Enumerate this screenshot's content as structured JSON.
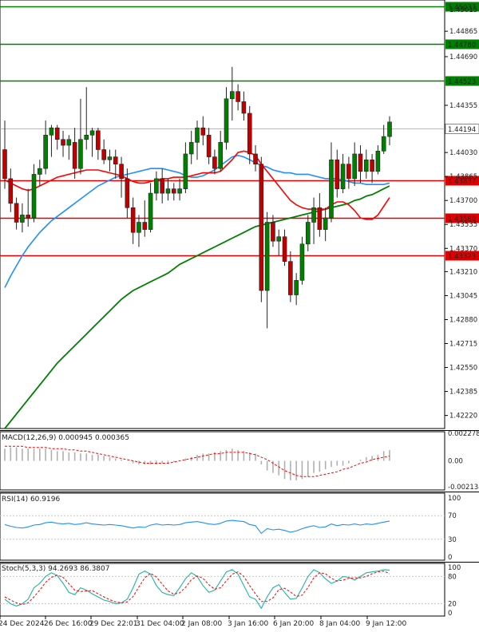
{
  "chart_data": [
    {
      "type": "candlestick",
      "panel": "main",
      "ylim": [
        1.4213,
        1.4508
      ],
      "yticks": [
        "1.44865",
        "1.44690",
        "1.44355",
        "1.44030",
        "1.43865",
        "1.43700",
        "1.43535",
        "1.43370",
        "1.43210",
        "1.43045",
        "1.42880",
        "1.42715",
        "1.42550",
        "1.42385",
        "1.42220"
      ],
      "ytick_top_partial": [
        "1.45180",
        "1.45015"
      ],
      "current_price": "1.44194",
      "levels": [
        {
          "price": "1.45037",
          "color": "#008000"
        },
        {
          "price": "1.44780",
          "color": "#008000"
        },
        {
          "price": "1.44523",
          "color": "#008000"
        },
        {
          "price": "1.43837",
          "color": "#e00000"
        },
        {
          "price": "1.43580",
          "color": "#e00000"
        },
        {
          "price": "1.43323",
          "color": "#e00000"
        }
      ],
      "candles": [
        [
          1.4405,
          1.4425,
          1.4378,
          1.4385
        ],
        [
          1.4385,
          1.4392,
          1.4362,
          1.4368
        ],
        [
          1.4368,
          1.4372,
          1.435,
          1.4355
        ],
        [
          1.4355,
          1.4368,
          1.4348,
          1.436
        ],
        [
          1.436,
          1.4378,
          1.4352,
          1.4358
        ],
        [
          1.4358,
          1.4395,
          1.4355,
          1.4388
        ],
        [
          1.4388,
          1.4398,
          1.438,
          1.4392
        ],
        [
          1.4392,
          1.4425,
          1.4388,
          1.4415
        ],
        [
          1.4415,
          1.4422,
          1.44,
          1.442
        ],
        [
          1.442,
          1.4422,
          1.4405,
          1.4412
        ],
        [
          1.4412,
          1.4418,
          1.44,
          1.4408
        ],
        [
          1.4408,
          1.4415,
          1.4398,
          1.4412
        ],
        [
          1.441,
          1.442,
          1.4385,
          1.4392
        ],
        [
          1.4392,
          1.444,
          1.4388,
          1.4412
        ],
        [
          1.4412,
          1.4448,
          1.4405,
          1.4415
        ],
        [
          1.4415,
          1.442,
          1.44,
          1.4418
        ],
        [
          1.4418,
          1.442,
          1.4398,
          1.4405
        ],
        [
          1.4405,
          1.4412,
          1.4395,
          1.4398
        ],
        [
          1.4398,
          1.4405,
          1.439,
          1.44
        ],
        [
          1.44,
          1.4405,
          1.4385,
          1.4395
        ],
        [
          1.4395,
          1.44,
          1.4372,
          1.4385
        ],
        [
          1.4385,
          1.4392,
          1.4358,
          1.4365
        ],
        [
          1.4365,
          1.4372,
          1.434,
          1.4348
        ],
        [
          1.4348,
          1.436,
          1.4338,
          1.4355
        ],
        [
          1.4355,
          1.437,
          1.4345,
          1.435
        ],
        [
          1.435,
          1.4382,
          1.4348,
          1.4375
        ],
        [
          1.4375,
          1.439,
          1.437,
          1.4385
        ],
        [
          1.4385,
          1.4392,
          1.4368,
          1.4375
        ],
        [
          1.4375,
          1.4385,
          1.437,
          1.4378
        ],
        [
          1.4378,
          1.4382,
          1.437,
          1.4375
        ],
        [
          1.4375,
          1.4385,
          1.437,
          1.4378
        ],
        [
          1.4378,
          1.441,
          1.4375,
          1.4402
        ],
        [
          1.4402,
          1.4418,
          1.4395,
          1.441
        ],
        [
          1.441,
          1.4425,
          1.4398,
          1.442
        ],
        [
          1.442,
          1.4428,
          1.4408,
          1.4415
        ],
        [
          1.4415,
          1.442,
          1.4395,
          1.44
        ],
        [
          1.44,
          1.4405,
          1.4388,
          1.4392
        ],
        [
          1.4392,
          1.4418,
          1.439,
          1.441
        ],
        [
          1.441,
          1.4448,
          1.4405,
          1.444
        ],
        [
          1.444,
          1.4462,
          1.4425,
          1.4445
        ],
        [
          1.4445,
          1.445,
          1.4432,
          1.4438
        ],
        [
          1.4438,
          1.4445,
          1.4425,
          1.443
        ],
        [
          1.443,
          1.4435,
          1.4395,
          1.4402
        ],
        [
          1.4402,
          1.4408,
          1.439,
          1.4395
        ],
        [
          1.4395,
          1.44,
          1.43,
          1.4308
        ],
        [
          1.4308,
          1.4362,
          1.4282,
          1.4355
        ],
        [
          1.4355,
          1.436,
          1.4338,
          1.4342
        ],
        [
          1.4342,
          1.435,
          1.4332,
          1.4345
        ],
        [
          1.4345,
          1.435,
          1.4325,
          1.4328
        ],
        [
          1.4328,
          1.4335,
          1.43,
          1.4305
        ],
        [
          1.4305,
          1.432,
          1.4298,
          1.4315
        ],
        [
          1.4315,
          1.4345,
          1.4312,
          1.434
        ],
        [
          1.434,
          1.436,
          1.4335,
          1.4355
        ],
        [
          1.4355,
          1.4372,
          1.434,
          1.4365
        ],
        [
          1.4365,
          1.4375,
          1.4345,
          1.435
        ],
        [
          1.435,
          1.4365,
          1.4342,
          1.4358
        ],
        [
          1.4358,
          1.441,
          1.4355,
          1.4398
        ],
        [
          1.4398,
          1.4405,
          1.4372,
          1.4378
        ],
        [
          1.4378,
          1.4402,
          1.4375,
          1.4395
        ],
        [
          1.4395,
          1.44,
          1.4378,
          1.4385
        ],
        [
          1.4385,
          1.441,
          1.438,
          1.4402
        ],
        [
          1.4402,
          1.4408,
          1.4382,
          1.439
        ],
        [
          1.439,
          1.4405,
          1.4385,
          1.4398
        ],
        [
          1.4398,
          1.4402,
          1.4382,
          1.439
        ],
        [
          1.439,
          1.4408,
          1.4388,
          1.4404
        ],
        [
          1.4404,
          1.4422,
          1.4402,
          1.4414
        ],
        [
          1.4414,
          1.4428,
          1.4408,
          1.4424
        ]
      ],
      "ma_red": [
        1.4384,
        1.4382,
        1.438,
        1.4378,
        1.4377,
        1.4378,
        1.438,
        1.4382,
        1.4384,
        1.4386,
        1.4387,
        1.4388,
        1.4389,
        1.439,
        1.4391,
        1.4391,
        1.4391,
        1.439,
        1.4389,
        1.4388,
        1.4387,
        1.4385,
        1.4383,
        1.4382,
        1.4382,
        1.4383,
        1.4384,
        1.4385,
        1.4385,
        1.4386,
        1.4386,
        1.4386,
        1.4387,
        1.4388,
        1.4389,
        1.4389,
        1.4389,
        1.439,
        1.4394,
        1.4398,
        1.4403,
        1.4404,
        1.4403,
        1.4401,
        1.4395,
        1.439,
        1.4385,
        1.438,
        1.4375,
        1.437,
        1.4367,
        1.4365,
        1.4364,
        1.4364,
        1.4364,
        1.4364,
        1.4367,
        1.4369,
        1.4369,
        1.4367,
        1.4363,
        1.4358,
        1.4357,
        1.4357,
        1.436,
        1.4366,
        1.4372
      ],
      "ma_blue": [
        1.431,
        1.4318,
        1.4325,
        1.4332,
        1.4338,
        1.4343,
        1.4348,
        1.4352,
        1.4356,
        1.4359,
        1.4362,
        1.4365,
        1.4368,
        1.4371,
        1.4374,
        1.4377,
        1.438,
        1.4382,
        1.4384,
        1.4386,
        1.4387,
        1.4388,
        1.4389,
        1.439,
        1.4391,
        1.4392,
        1.4392,
        1.4392,
        1.4391,
        1.439,
        1.4389,
        1.4387,
        1.4386,
        1.4386,
        1.4387,
        1.4389,
        1.4391,
        1.4394,
        1.4397,
        1.44,
        1.4401,
        1.44,
        1.4398,
        1.4396,
        1.4394,
        1.4393,
        1.4391,
        1.439,
        1.4389,
        1.4389,
        1.4388,
        1.4388,
        1.4388,
        1.4387,
        1.4386,
        1.4385,
        1.4385,
        1.4385,
        1.4384,
        1.4383,
        1.4382,
        1.4382,
        1.4381,
        1.4381,
        1.4381,
        1.4381,
        1.4382
      ],
      "ma_green": [
        1.4213,
        1.4218,
        1.4223,
        1.4228,
        1.4233,
        1.4238,
        1.4243,
        1.4248,
        1.4253,
        1.4258,
        1.4262,
        1.4266,
        1.427,
        1.4274,
        1.4278,
        1.4282,
        1.4286,
        1.429,
        1.4294,
        1.4298,
        1.4302,
        1.4305,
        1.4308,
        1.431,
        1.4312,
        1.4314,
        1.4316,
        1.4318,
        1.432,
        1.4323,
        1.4326,
        1.4328,
        1.433,
        1.4332,
        1.4334,
        1.4336,
        1.4338,
        1.434,
        1.4342,
        1.4344,
        1.4346,
        1.4348,
        1.435,
        1.4352,
        1.4353,
        1.4354,
        1.4355,
        1.4356,
        1.4357,
        1.4358,
        1.4359,
        1.436,
        1.4361,
        1.4362,
        1.4363,
        1.4364,
        1.4365,
        1.4366,
        1.4367,
        1.4368,
        1.437,
        1.4371,
        1.4373,
        1.4374,
        1.4376,
        1.4378,
        1.438
      ]
    },
    {
      "type": "bar",
      "panel": "macd",
      "label": "MACD(12,26,9) 0.000945 0.000365",
      "ylim": [
        -0.0024,
        0.0024
      ],
      "yticks": [
        "0.002278",
        "0.00",
        "-0.002134"
      ],
      "histogram": [
        0.001,
        0.0011,
        0.0011,
        0.001,
        0.001,
        0.001,
        0.001,
        0.001,
        0.0009,
        0.0008,
        0.0008,
        0.0007,
        0.0007,
        0.0006,
        0.0006,
        0.0005,
        0.0005,
        0.0004,
        0.0003,
        0.0002,
        0.0001,
        0.0,
        -0.0002,
        -0.0003,
        -0.0003,
        -0.0003,
        -0.0003,
        -0.0002,
        -0.0002,
        -0.0001,
        0.0,
        0.0002,
        0.0003,
        0.0005,
        0.0006,
        0.0006,
        0.0007,
        0.0008,
        0.0009,
        0.001,
        0.0009,
        0.0008,
        0.0007,
        0.0006,
        -0.0003,
        -0.0008,
        -0.001,
        -0.0012,
        -0.0015,
        -0.0016,
        -0.0016,
        -0.0015,
        -0.0013,
        -0.001,
        -0.0009,
        -0.0007,
        -0.0005,
        -0.0004,
        -0.0004,
        -0.0002,
        0.0,
        0.0001,
        0.0003,
        0.0004,
        0.0005,
        0.0008,
        0.0009
      ],
      "signal": [
        0.0012,
        0.0012,
        0.0012,
        0.0012,
        0.0011,
        0.0011,
        0.0011,
        0.0011,
        0.001,
        0.001,
        0.001,
        0.0009,
        0.0009,
        0.0008,
        0.0008,
        0.0007,
        0.0006,
        0.0005,
        0.0004,
        0.0003,
        0.0002,
        0.0001,
        0.0,
        -0.0001,
        -0.0002,
        -0.0002,
        -0.0002,
        -0.0002,
        -0.0002,
        -0.0001,
        0.0,
        0.0001,
        0.0002,
        0.0003,
        0.0004,
        0.0005,
        0.0006,
        0.0006,
        0.0007,
        0.0007,
        0.0007,
        0.0007,
        0.0006,
        0.0005,
        0.0003,
        0.0001,
        -0.0002,
        -0.0005,
        -0.0008,
        -0.001,
        -0.0012,
        -0.0013,
        -0.0013,
        -0.0013,
        -0.0012,
        -0.0011,
        -0.001,
        -0.0009,
        -0.0007,
        -0.0006,
        -0.0004,
        -0.0002,
        -0.0001,
        0.0001,
        0.0002,
        0.0003,
        0.0004
      ]
    },
    {
      "type": "line",
      "panel": "rsi",
      "label": "RSI(14) 60.9196",
      "ylim": [
        0,
        100
      ],
      "yticks": [
        "100",
        "70",
        "30",
        "0"
      ],
      "values": [
        55,
        52,
        50,
        49,
        51,
        54,
        55,
        58,
        59,
        57,
        56,
        57,
        55,
        56,
        58,
        56,
        55,
        54,
        55,
        54,
        53,
        51,
        49,
        51,
        50,
        54,
        56,
        54,
        55,
        54,
        55,
        58,
        59,
        60,
        58,
        56,
        55,
        57,
        61,
        62,
        61,
        60,
        55,
        53,
        40,
        48,
        46,
        47,
        45,
        42,
        44,
        48,
        51,
        53,
        50,
        51,
        56,
        53,
        55,
        54,
        56,
        54,
        56,
        55,
        57,
        59,
        61
      ]
    },
    {
      "type": "line",
      "panel": "stoch",
      "label": "Stoch(5,3,3) 94.2693 86.3807",
      "ylim": [
        0,
        100
      ],
      "yticks": [
        "100",
        "80",
        "20",
        "0"
      ],
      "k": [
        30,
        20,
        15,
        20,
        30,
        55,
        65,
        80,
        88,
        82,
        65,
        45,
        40,
        55,
        50,
        42,
        35,
        28,
        25,
        20,
        22,
        30,
        55,
        85,
        92,
        85,
        60,
        45,
        40,
        38,
        55,
        75,
        88,
        80,
        60,
        45,
        50,
        70,
        90,
        95,
        85,
        60,
        35,
        30,
        10,
        35,
        55,
        62,
        45,
        30,
        32,
        55,
        80,
        95,
        88,
        75,
        65,
        70,
        80,
        78,
        72,
        80,
        88,
        90,
        92,
        95,
        94
      ],
      "d": [
        35,
        28,
        22,
        18,
        22,
        35,
        50,
        67,
        78,
        83,
        78,
        64,
        50,
        47,
        48,
        49,
        42,
        35,
        29,
        24,
        22,
        24,
        36,
        57,
        77,
        87,
        79,
        63,
        48,
        41,
        44,
        56,
        73,
        81,
        76,
        62,
        52,
        55,
        70,
        85,
        90,
        80,
        60,
        42,
        25,
        25,
        33,
        51,
        54,
        46,
        36,
        39,
        56,
        77,
        88,
        86,
        76,
        70,
        72,
        76,
        77,
        77,
        80,
        86,
        90,
        92,
        86
      ]
    }
  ],
  "xlabels": [
    "24 Dec 2024",
    "26 Dec 16:00",
    "29 Dec 22:01",
    "31 Dec 04:00",
    "2 Jan 08:00",
    "3 Jan 16:00",
    "6 Jan 20:00",
    "8 Jan 04:00",
    "9 Jan 12:00"
  ],
  "colors": {
    "bull": "#008000",
    "bear": "#c00000",
    "ma_red": "#ff0000",
    "ma_blue": "#1e90ff",
    "ma_green": "#008000",
    "macd_hist": "#b0b0b0",
    "macd_signal": "#ff0000",
    "rsi": "#1e90ff",
    "stoch_k": "#20b2aa",
    "stoch_d": "#ff0000"
  }
}
